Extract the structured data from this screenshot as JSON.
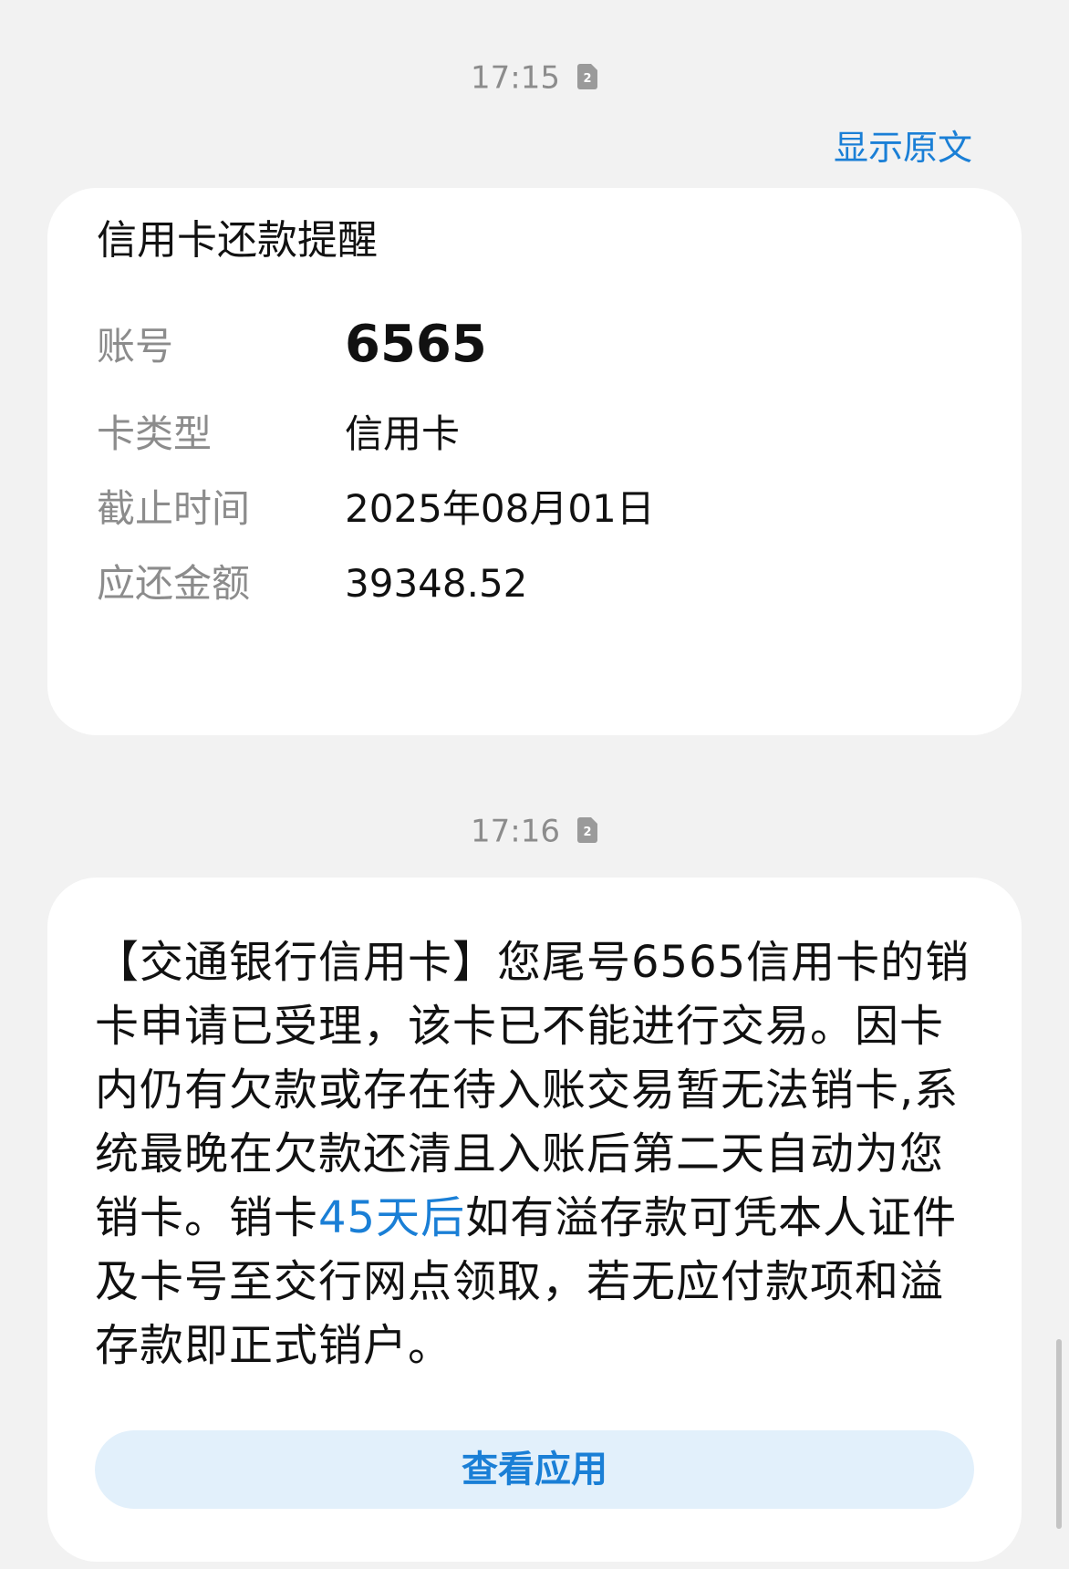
{
  "messages": [
    {
      "time": "17:15",
      "sim_icon": "sim-2-icon",
      "sim_number": "2"
    },
    {
      "time": "17:16",
      "sim_icon": "sim-2-icon",
      "sim_number": "2"
    }
  ],
  "show_original_label": "显示原文",
  "reminder_card": {
    "title": "信用卡还款提醒",
    "rows": [
      {
        "label": "账号",
        "value": "6565"
      },
      {
        "label": "卡类型",
        "value": "信用卡"
      },
      {
        "label": "截止时间",
        "value": "2025年08月01日"
      },
      {
        "label": "应还金额",
        "value": "39348.52"
      }
    ]
  },
  "sms": {
    "part1": "【交通银行信用卡】您尾号6565信用卡的销卡申请已受理，该卡已不能进行交易。因卡内仍有欠款或存在待入账交易暂无法销卡,系统最晚在欠款还清且入账后第二天自动为您销卡。销卡",
    "highlight": "45天后",
    "part2": "如有溢存款可凭本人证件及卡号至交行网点领取，若无应付款项和溢存款即正式销户。"
  },
  "view_app_label": "查看应用",
  "colors": {
    "accent": "#1a7fd6",
    "background": "#f2f2f2",
    "card": "#ffffff",
    "button_bg": "#e2f0fb",
    "muted_text": "#8c8c8c"
  }
}
